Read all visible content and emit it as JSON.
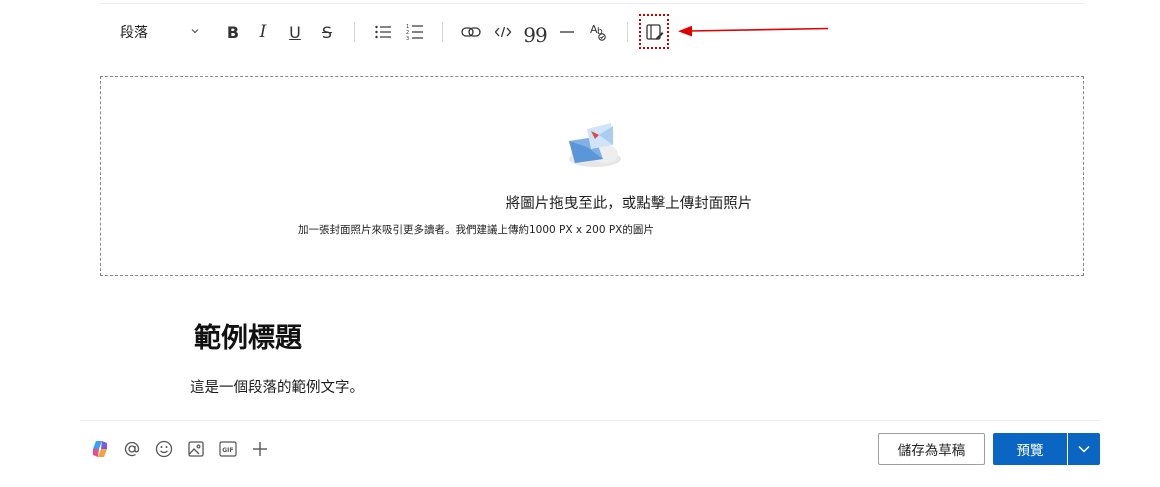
{
  "toolbar": {
    "paragraph_style": "段落",
    "bold": "B",
    "italic": "I",
    "underline": "U",
    "strikethrough": "S",
    "bulleted_list_icon": "bulleted-list-icon",
    "numbered_list_icon": "numbered-list-icon",
    "link_icon": "link-icon",
    "code_icon": "code-icon",
    "quote": "99",
    "divider_icon": "horizontal-rule-icon",
    "spellcheck_icon": "spellcheck-icon",
    "highlighted_tool_icon": "note-edit-icon"
  },
  "annotation": {
    "highlight_color": "#c00000",
    "arrow_color": "#e00000"
  },
  "cover": {
    "illustration": "cloud-upload-illustration",
    "main_text": "將圖片拖曳至此，或點擊上傳封面照片",
    "sub_text": "加一張封面照片來吸引更多讀者。我們建議上傳約1000 PX x 200 PX的圖片"
  },
  "document": {
    "title": "範例標題",
    "body": "這是一個段落的範例文字。"
  },
  "bottom_bar": {
    "icons": [
      "copilot-icon",
      "mention-icon",
      "emoji-icon",
      "image-icon",
      "gif-icon",
      "add-icon"
    ],
    "gif_label": "GIF",
    "save_draft_label": "儲存為草稿",
    "preview_label": "預覽"
  },
  "colors": {
    "primary": "#0a66c2"
  }
}
